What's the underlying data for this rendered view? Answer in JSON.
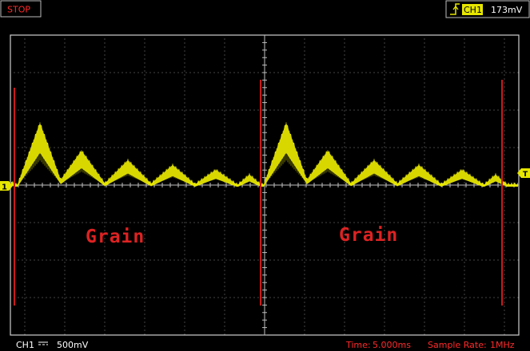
{
  "status": {
    "run_state": "STOP"
  },
  "trigger": {
    "channel": "CH1",
    "level": "173mV",
    "edge_icon": "rising-edge-icon"
  },
  "markers": {
    "channel_marker": "1",
    "trigger_marker": "T"
  },
  "annotations": [
    "Grain",
    "Grain"
  ],
  "footer": {
    "channel": "CH1",
    "coupling_icon": "dc-coupling-icon",
    "volts_per_div": "500mV",
    "time_label": "Time:",
    "time_per_div": "5.000ms",
    "sample_rate_label": "Sample Rate:",
    "sample_rate": "1MHz"
  },
  "colors": {
    "waveform": "#e6e600",
    "marker_line": "#cc1a1a",
    "annotation": "#dd2222",
    "grid": "#8a8a8a",
    "frame": "#cfcfcf",
    "status_text": "#ff2a2a",
    "trigger_badge": "#e6e600"
  }
}
